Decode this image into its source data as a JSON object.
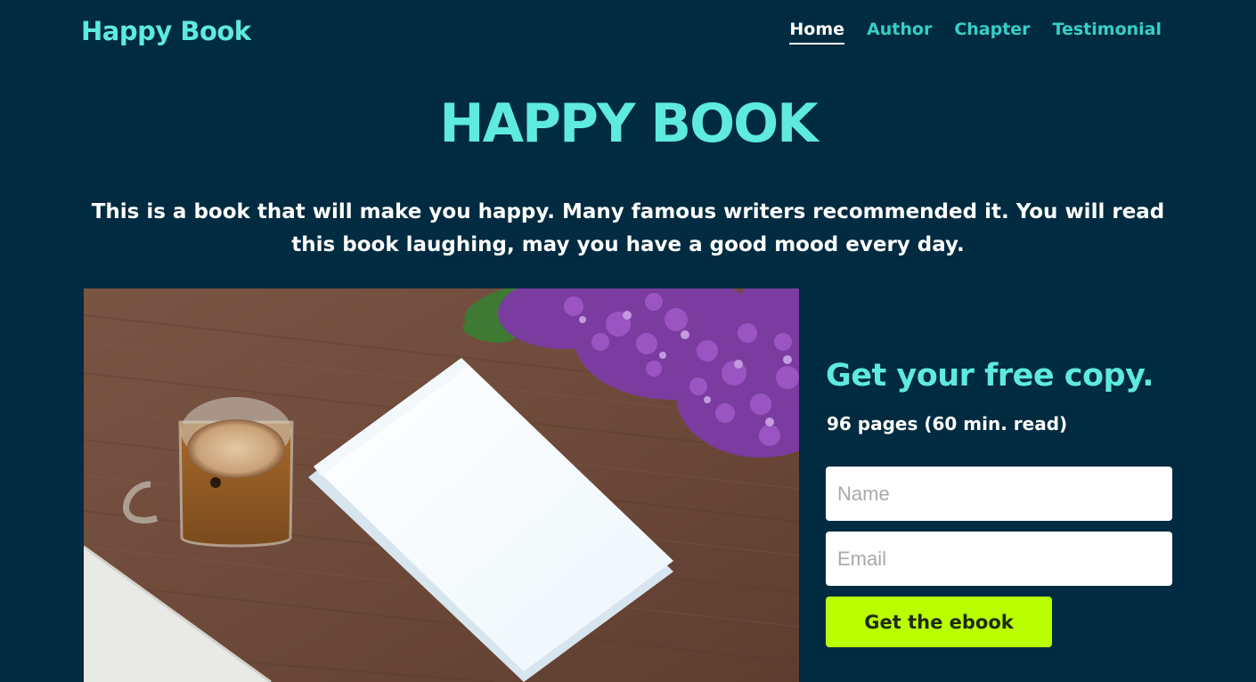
{
  "header": {
    "brand": "Happy Book",
    "nav": [
      {
        "label": "Home",
        "active": true
      },
      {
        "label": "Author",
        "active": false
      },
      {
        "label": "Chapter",
        "active": false
      },
      {
        "label": "Testimonial",
        "active": false
      }
    ]
  },
  "hero": {
    "title": "HAPPY BOOK",
    "description": "This is a book that will make you happy. Many famous writers recommended it. You will read this book laughing, may you have a good mood every day."
  },
  "photo": {
    "subject": "coffee-book-lilac-photo"
  },
  "signup": {
    "title": "Get your free copy.",
    "meta": "96 pages (60 min. read)",
    "name_placeholder": "Name",
    "email_placeholder": "Email",
    "button_label": "Get the ebook"
  },
  "colors": {
    "background": "#002b40",
    "accent": "#5eeadf",
    "nav_link": "#35cfc8",
    "button": "#b9ff00"
  }
}
